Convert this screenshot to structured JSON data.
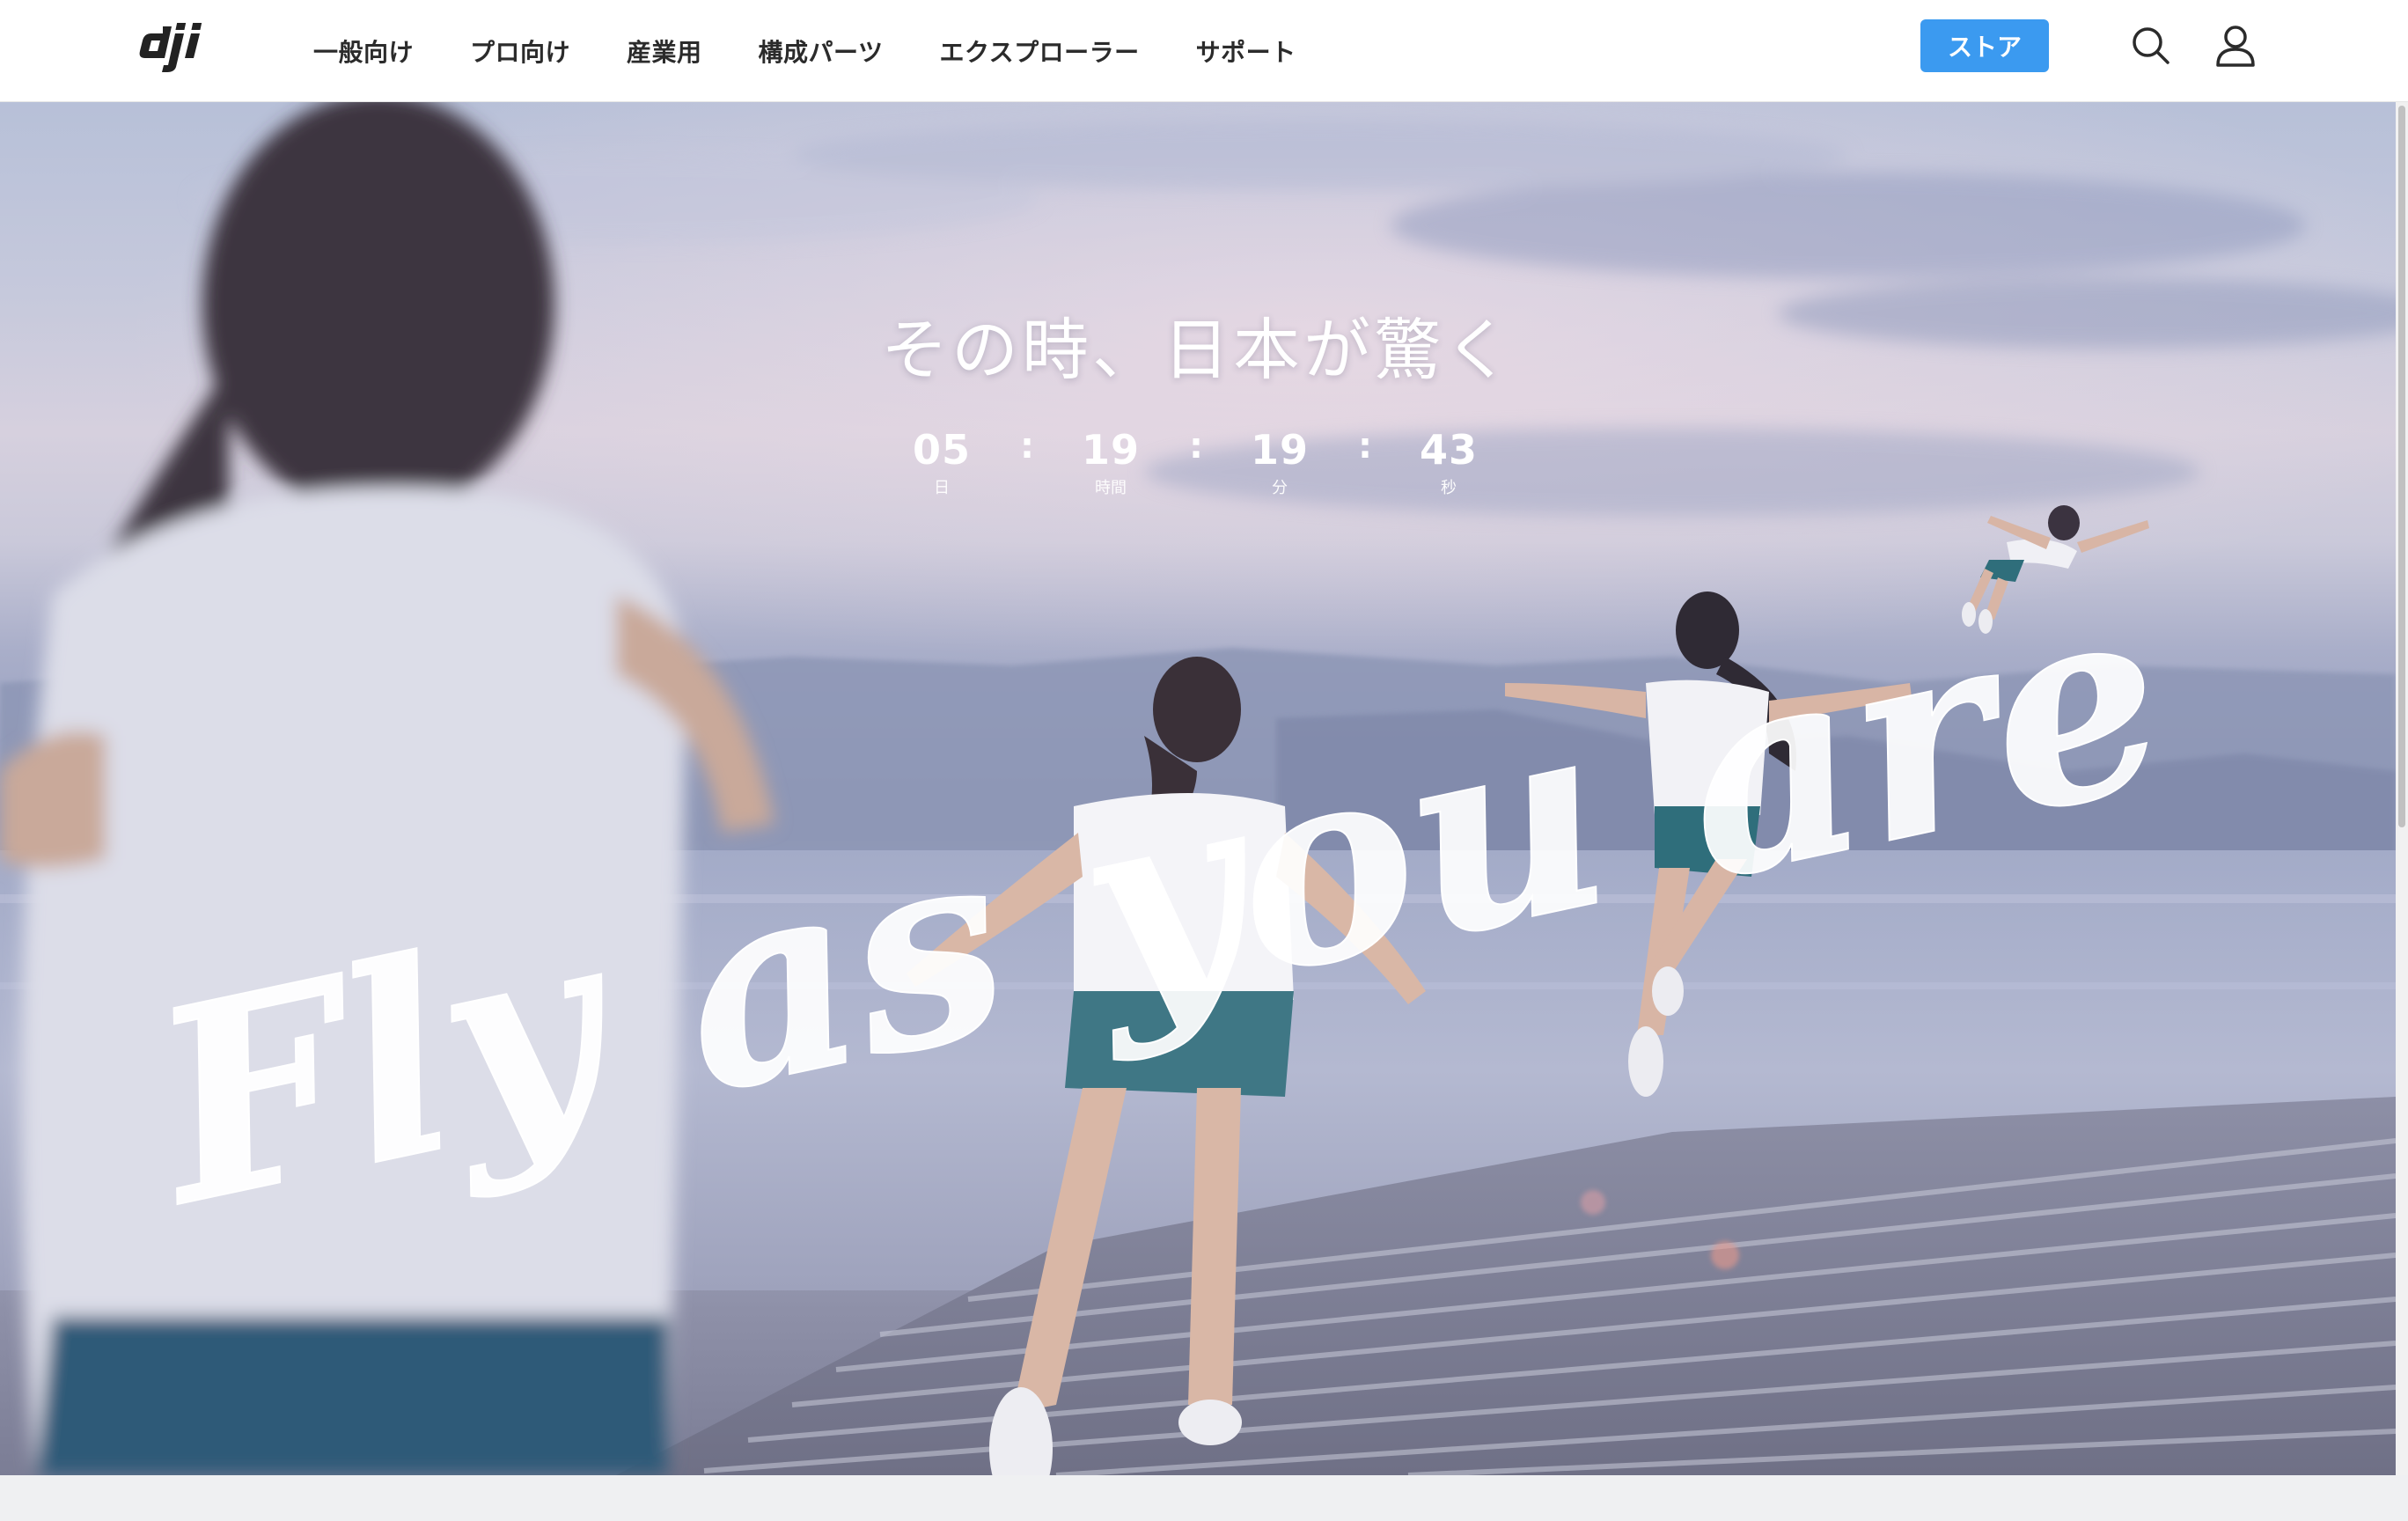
{
  "brand": {
    "logo_alt": "dji"
  },
  "nav": {
    "items": [
      {
        "label": "一般向け"
      },
      {
        "label": "プロ向け"
      },
      {
        "label": "産業用"
      },
      {
        "label": "構成パーツ"
      },
      {
        "label": "エクスプローラー"
      },
      {
        "label": "サポート"
      }
    ],
    "store_label": "ストア",
    "search_icon": "search-icon",
    "user_icon": "user-icon"
  },
  "hero": {
    "headline": "その時、日本が驚く",
    "slogan": "Fly as you are",
    "countdown": {
      "days": "05",
      "days_label": "日",
      "hours": "19",
      "hours_label": "時間",
      "minutes": "19",
      "minutes_label": "分",
      "seconds": "43",
      "seconds_label": "秒",
      "separator": ":"
    }
  },
  "colors": {
    "store_button": "#3b9af0",
    "nav_text": "#2b2b2b",
    "hero_text": "#ffffff"
  }
}
